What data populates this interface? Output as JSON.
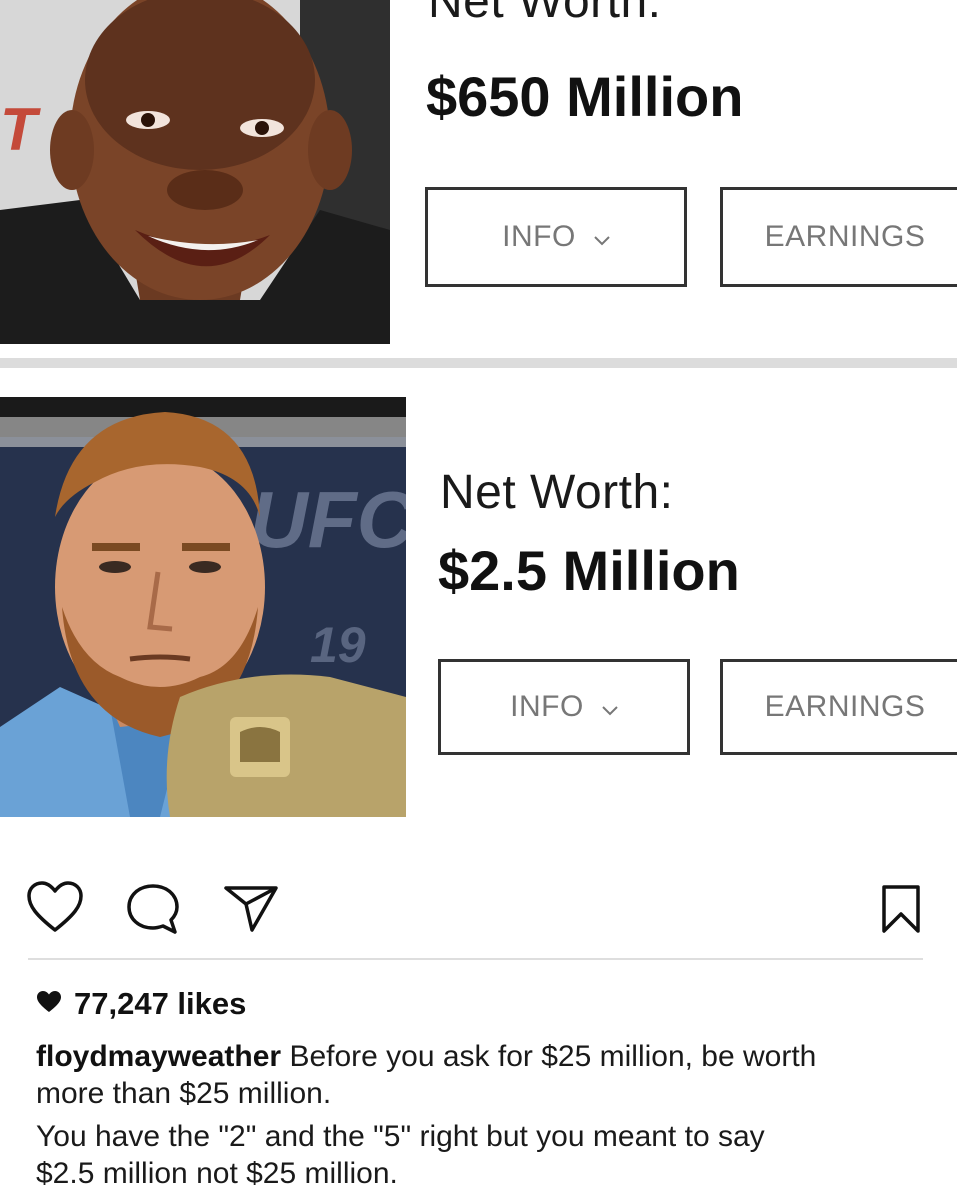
{
  "card1": {
    "label": "Net Worth:",
    "value": "$650 Million",
    "info_button": "INFO",
    "earnings_button": "EARNINGS",
    "photo_sign_text": "T"
  },
  "card2": {
    "label": "Net Worth:",
    "value": "$2.5 Million",
    "info_button": "INFO",
    "earnings_button": "EARNINGS",
    "photo_sign_text": "UFC",
    "photo_sign_number": "19"
  },
  "post": {
    "likes": "77,247 likes",
    "username": "floydmayweather",
    "caption_line1": "Before you ask for $25 million, be worth",
    "caption_line2": "more than $25 million.",
    "caption_line3": "You have the \"2\" and the \"5\" right but you meant to say",
    "caption_line4": "$2.5 million not $25 million."
  },
  "icons": {
    "like": "heart-icon",
    "comment": "comment-icon",
    "share": "send-icon",
    "save": "bookmark-icon",
    "likes_heart": "heart-filled-icon"
  },
  "colors": {
    "divider": "#dcdcdc",
    "button_text": "#777777",
    "text": "#111111"
  }
}
